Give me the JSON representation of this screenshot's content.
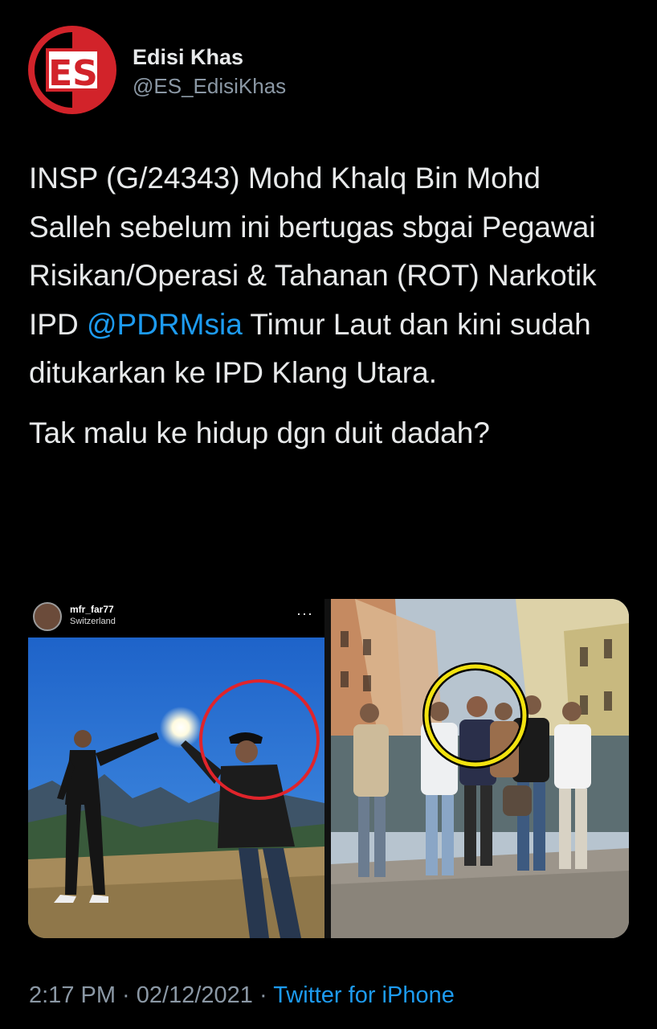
{
  "author": {
    "display_name": "Edisi Khas",
    "handle": "@ES_EdisiKhas",
    "avatar_label": "ES",
    "brand_color": "#d2232a"
  },
  "tweet": {
    "text_before_mention": "INSP (G/24343) Mohd Khalq Bin Mohd Salleh sebelum ini bertugas sbgai Pegawai Risikan/Operasi & Tahanan (ROT) Narkotik IPD ",
    "mention": "@PDRMsia",
    "text_after_mention": " Timur Laut dan kini sudah ditukarkan ke IPD Klang Utara.",
    "second_paragraph": "Tak malu ke hidup dgn duit dadah?"
  },
  "media": {
    "left": {
      "ig_username": "mfr_far77",
      "ig_location": "Switzerland",
      "ig_more": "···",
      "highlight_color": "#e0242b"
    },
    "right": {
      "highlight_color": "#f2e20f"
    }
  },
  "footer": {
    "time": "2:17 PM",
    "separator": " · ",
    "date": "02/12/2021",
    "separator2": " · ",
    "source": "Twitter for iPhone"
  },
  "colors": {
    "background": "#000000",
    "text": "#e7e9ea",
    "secondary": "#8b98a5",
    "link": "#1d9bf0"
  }
}
